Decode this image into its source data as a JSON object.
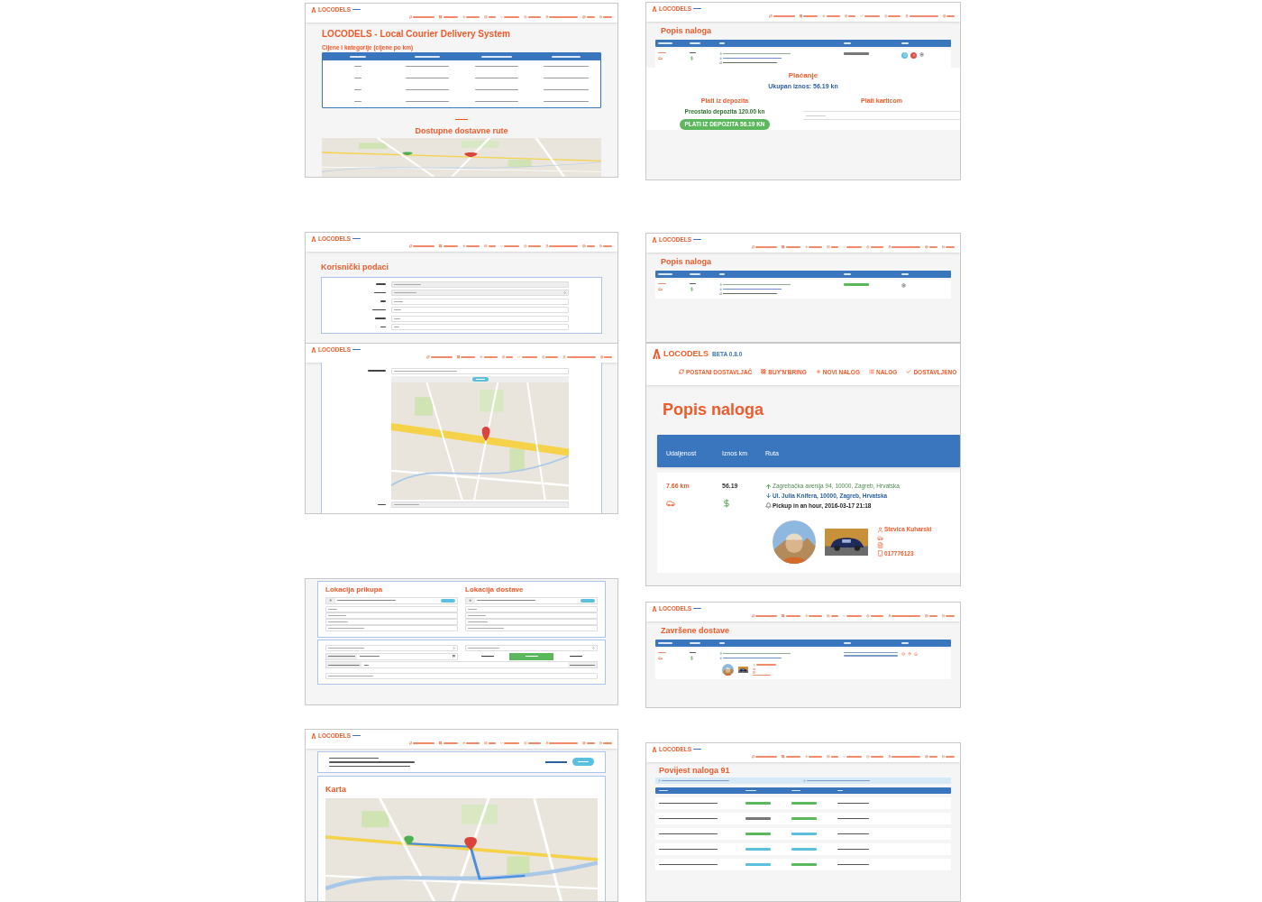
{
  "panels": [
    {
      "kind": "home",
      "header": {
        "logo": "LOCODELS"
      },
      "title": "LOCODELS - Local Courier Delivery System",
      "prices": {
        "title": "Cijene i kategorije (cijene po km)"
      },
      "routes_title": "Dostupne dostavne rute"
    },
    {
      "kind": "orders",
      "header": {
        "logo": "LOCODELS"
      },
      "title": "Popis naloga",
      "table": {
        "rows": [
          {
            "status": {
              "color": "#777777"
            }
          }
        ]
      },
      "payment": {
        "title": "Plaćanje",
        "total": "Ukupan iznos: 56.19 kn",
        "deposit_title": "Plati iz depozita",
        "remaining": "Preostalo depozita 120.00 kn",
        "deposit_button": "PLATI IZ DEPOZITA 56.19 KN",
        "card_title": "Plati karticom"
      }
    },
    {
      "kind": "profile",
      "header": {
        "logo": "LOCODELS"
      },
      "title": "Korisnički podaci"
    },
    {
      "kind": "orders",
      "header": {
        "logo": "LOCODELS"
      },
      "title": "Popis naloga",
      "table": {
        "rows": [
          {
            "status": {
              "color": "#5cb85c"
            }
          }
        ]
      }
    },
    {
      "kind": "address",
      "header": {
        "logo": "LOCODELS"
      }
    },
    {
      "kind": "orders",
      "header": {
        "logo": "LOCODELS",
        "version": "BETA 0.8.0",
        "nav": [
          "POSTANI DOSTAVLJAČ",
          "BUY'N'BRING",
          "NOVI NALOG",
          "NALOG",
          "DOSTAVLJENO"
        ]
      },
      "title": "Popis naloga",
      "table": {
        "columns": [
          "Udaljenost",
          "Iznos km",
          "Ruta"
        ],
        "rows": [
          {
            "distance": "7.66 km",
            "amount": "56.19",
            "from": "Zagrebačka avenija 94, 10000, Zagreb, Hrvatska",
            "to": "Ul. Julia Knifera, 10000, Zagreb, Hrvatska",
            "pickup": "Pickup in an hour, 2016-03-17 21:18",
            "driver": {
              "name": "Stevica Kuharski",
              "phone": "017776123"
            }
          }
        ]
      }
    },
    {
      "kind": "new_order",
      "pickup_title": "Lokacija prikupa",
      "delivery_title": "Lokacija dostave",
      "speeds": [
        {
          "selected": false
        },
        {
          "selected": true
        },
        {
          "selected": false
        }
      ]
    },
    {
      "kind": "orders",
      "header": {
        "logo": "LOCODELS"
      },
      "title": "Završene dostave"
    },
    {
      "kind": "summary",
      "header": {
        "logo": "LOCODELS"
      },
      "map_title": "Karta"
    },
    {
      "kind": "history",
      "header": {
        "logo": "LOCODELS"
      },
      "title": "Povijest naloga 91",
      "rows": [
        {
          "from": {
            "color": "#5cb85c"
          },
          "to": {
            "color": "#5cb85c"
          }
        },
        {
          "from": {
            "color": "#777777"
          },
          "to": {
            "color": "#5cb85c"
          }
        },
        {
          "from": {
            "color": "#5cb85c"
          },
          "to": {
            "color": "#5bc0de"
          }
        },
        {
          "from": {
            "color": "#5bc0de"
          },
          "to": {
            "color": "#5bc0de"
          }
        },
        {
          "from": {
            "color": "#5bc0de"
          },
          "to": {
            "color": "#5cb85c"
          }
        }
      ]
    }
  ]
}
